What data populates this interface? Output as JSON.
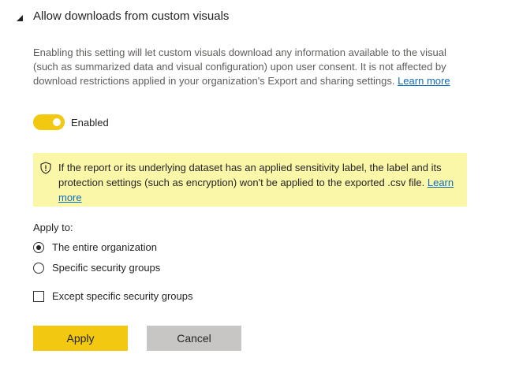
{
  "section": {
    "title": "Allow downloads from custom visuals",
    "expanded": true
  },
  "description": {
    "text": "Enabling this setting will let custom visuals download any information available to the visual (such as summarized data and visual configuration) upon user consent. It is not affected by download restrictions applied in your organization's Export and sharing settings. ",
    "link_label": "Learn more"
  },
  "toggle": {
    "label": "Enabled",
    "on": true,
    "color": "#f2c811"
  },
  "warning": {
    "icon": "shield-icon",
    "text": "If the report or its underlying dataset has an applied sensitivity label, the label and its protection settings (such as encryption) won't be applied to the exported .csv file. ",
    "link_label": "Learn more",
    "background": "#fbf7a9"
  },
  "apply_to": {
    "label": "Apply to:",
    "options": [
      {
        "label": "The entire organization",
        "selected": true
      },
      {
        "label": "Specific security groups",
        "selected": false
      }
    ],
    "except_label": "Except specific security groups",
    "except_checked": false
  },
  "buttons": {
    "apply_label": "Apply",
    "cancel_label": "Cancel"
  }
}
